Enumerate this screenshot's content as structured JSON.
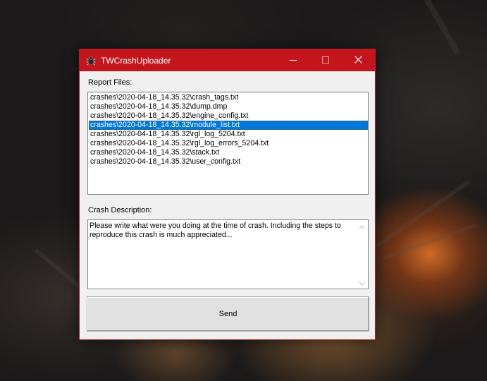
{
  "window": {
    "title": "TWCrashUploader",
    "accent_color": "#c4151c"
  },
  "report_files": {
    "label": "Report Files:",
    "items": [
      "crashes\\2020-04-18_14.35.32\\crash_tags.txt",
      "crashes\\2020-04-18_14.35.32\\dump.dmp",
      "crashes\\2020-04-18_14.35.32\\engine_config.txt",
      "crashes\\2020-04-18_14.35.32\\module_list.txt",
      "crashes\\2020-04-18_14.35.32\\rgl_log_5204.txt",
      "crashes\\2020-04-18_14.35.32\\rgl_log_errors_5204.txt",
      "crashes\\2020-04-18_14.35.32\\stack.txt",
      "crashes\\2020-04-18_14.35.32\\user_config.txt"
    ],
    "selected_index": 3,
    "selection_color": "#0078d7"
  },
  "crash_description": {
    "label": "Crash Description:",
    "text": "Please write what were you doing at the time of crash. Including the steps to reproduce this crash is much appreciated..."
  },
  "send_button": {
    "label": "Send"
  },
  "icons": {
    "app": "bug-icon",
    "minimize": "minimize-icon",
    "maximize": "maximize-icon",
    "close": "close-icon",
    "scroll_up": "chevron-up-icon",
    "scroll_down": "chevron-down-icon"
  }
}
